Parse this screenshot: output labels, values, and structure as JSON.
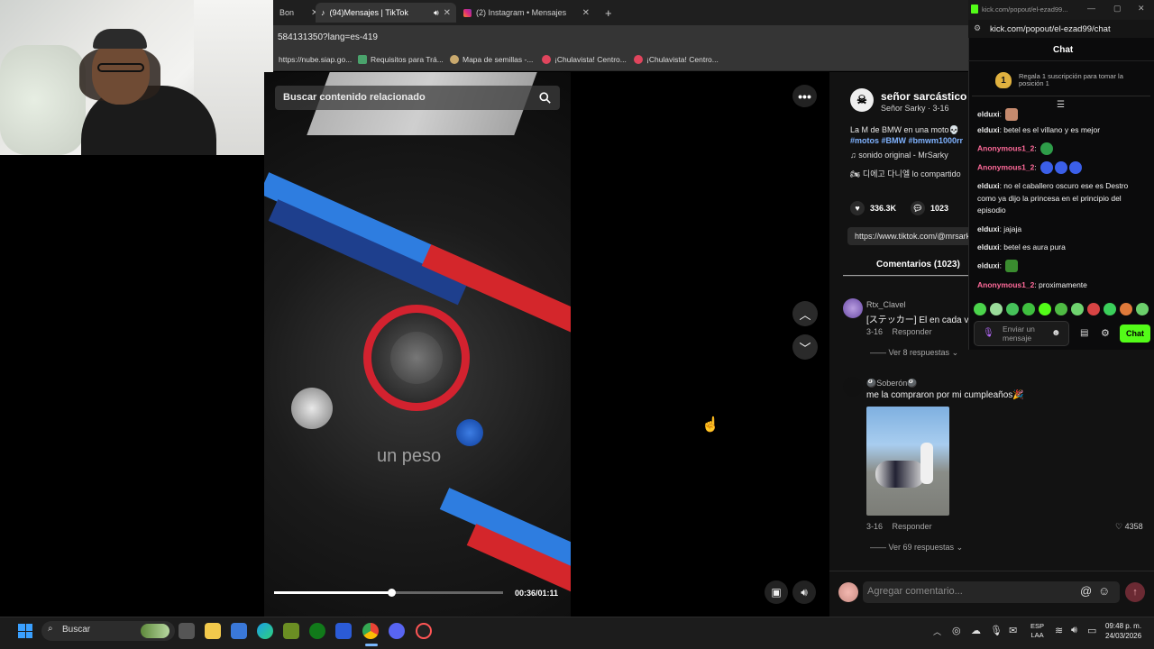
{
  "browser": {
    "tabs": [
      {
        "label": "Bon",
        "active": false
      },
      {
        "label": "(94)Mensajes | TikTok",
        "active": true
      },
      {
        "label": "(2) Instagram • Mensajes",
        "active": false
      }
    ],
    "url": "584131350?lang=es-419",
    "bookmarks": [
      {
        "label": "https://nube.siap.go...",
        "icon_color": "#6b9bd1"
      },
      {
        "label": "Requisitos para Trá...",
        "icon_color": "#4aa36c"
      },
      {
        "label": "Mapa de semillas -...",
        "icon_color": "#c9a96e"
      },
      {
        "label": "¡Chulavista! Centro...",
        "icon_color": "#e0455d"
      },
      {
        "label": "¡Chulavista! Centro...",
        "icon_color": "#e0455d"
      }
    ]
  },
  "video": {
    "search_placeholder": "Buscar contenido relacionado",
    "subtitle": "un peso",
    "time": "00:36/01:11",
    "progress": 0.51
  },
  "post": {
    "author_name": "señor sarcástico",
    "author_sub": "Señor Sarky · 3-16",
    "caption": "La M de BMW en una moto💀",
    "tags": "#motos #BMW #bmwm1000rr",
    "sound": "♫  sonido original - MrSarky",
    "translate": "🏍 디에고 다니엘 lo compartido",
    "likes": "336.3K",
    "comments_count": "1023",
    "link": "https://www.tiktok.com/@mrsarky",
    "comments_tab": "Comentarios (1023)"
  },
  "comments": [
    {
      "name": "Rtx_Clavel",
      "text": "[ステッカー] El en cada v",
      "date": "3-16",
      "reply": "Responder",
      "replies": "Ver 8 respuestas"
    },
    {
      "name": "🎱Soberón🎱",
      "text": "me la compraron por mi cumpleaños🎉",
      "date": "3-16",
      "reply": "Responder",
      "replies": "Ver 69 respuestas",
      "likes": "4358"
    }
  ],
  "comment_input_placeholder": "Agregar comentario...",
  "kick": {
    "titlebar_url": "kick.com/popout/el-ezad99...",
    "url": "kick.com/popout/el-ezad99/chat",
    "header": "Chat",
    "sub_badge": "1",
    "sub_text": "Regala 1 suscripción para tomar la posición 1",
    "messages": [
      {
        "user": "elduxi",
        "text": "",
        "emotes": 1,
        "color": "u1"
      },
      {
        "user": "elduxi",
        "text": "betel es el villano y es mejor",
        "emotes": 0,
        "color": "u1"
      },
      {
        "user": "Anonymous1_2",
        "text": "",
        "emotes": 1,
        "color": "u2"
      },
      {
        "user": "Anonymous1_2",
        "text": "",
        "emotes": 3,
        "color": "u2"
      },
      {
        "user": "elduxi",
        "text": "no el caballero oscuro ese es Destro como ya dijo la princesa en el principio del episodio",
        "emotes": 0,
        "color": "u1"
      },
      {
        "user": "elduxi",
        "text": "jajaja",
        "emotes": 0,
        "color": "u1"
      },
      {
        "user": "elduxi",
        "text": "betel es aura pura",
        "emotes": 0,
        "color": "u1"
      },
      {
        "user": "elduxi",
        "text": "",
        "emotes": 1,
        "color": "u1"
      },
      {
        "user": "Anonymous1_2",
        "text": "proximamente",
        "emotes": 0,
        "color": "u2"
      }
    ],
    "input_placeholder": "Enviar un mensaje",
    "send_label": "Chat",
    "accent": "#53fc18"
  },
  "taskbar": {
    "search_label": "Buscar",
    "lang_line1": "ESP",
    "lang_line2": "LAA",
    "time": "09:48 p. m.",
    "date": "24/03/2026"
  }
}
